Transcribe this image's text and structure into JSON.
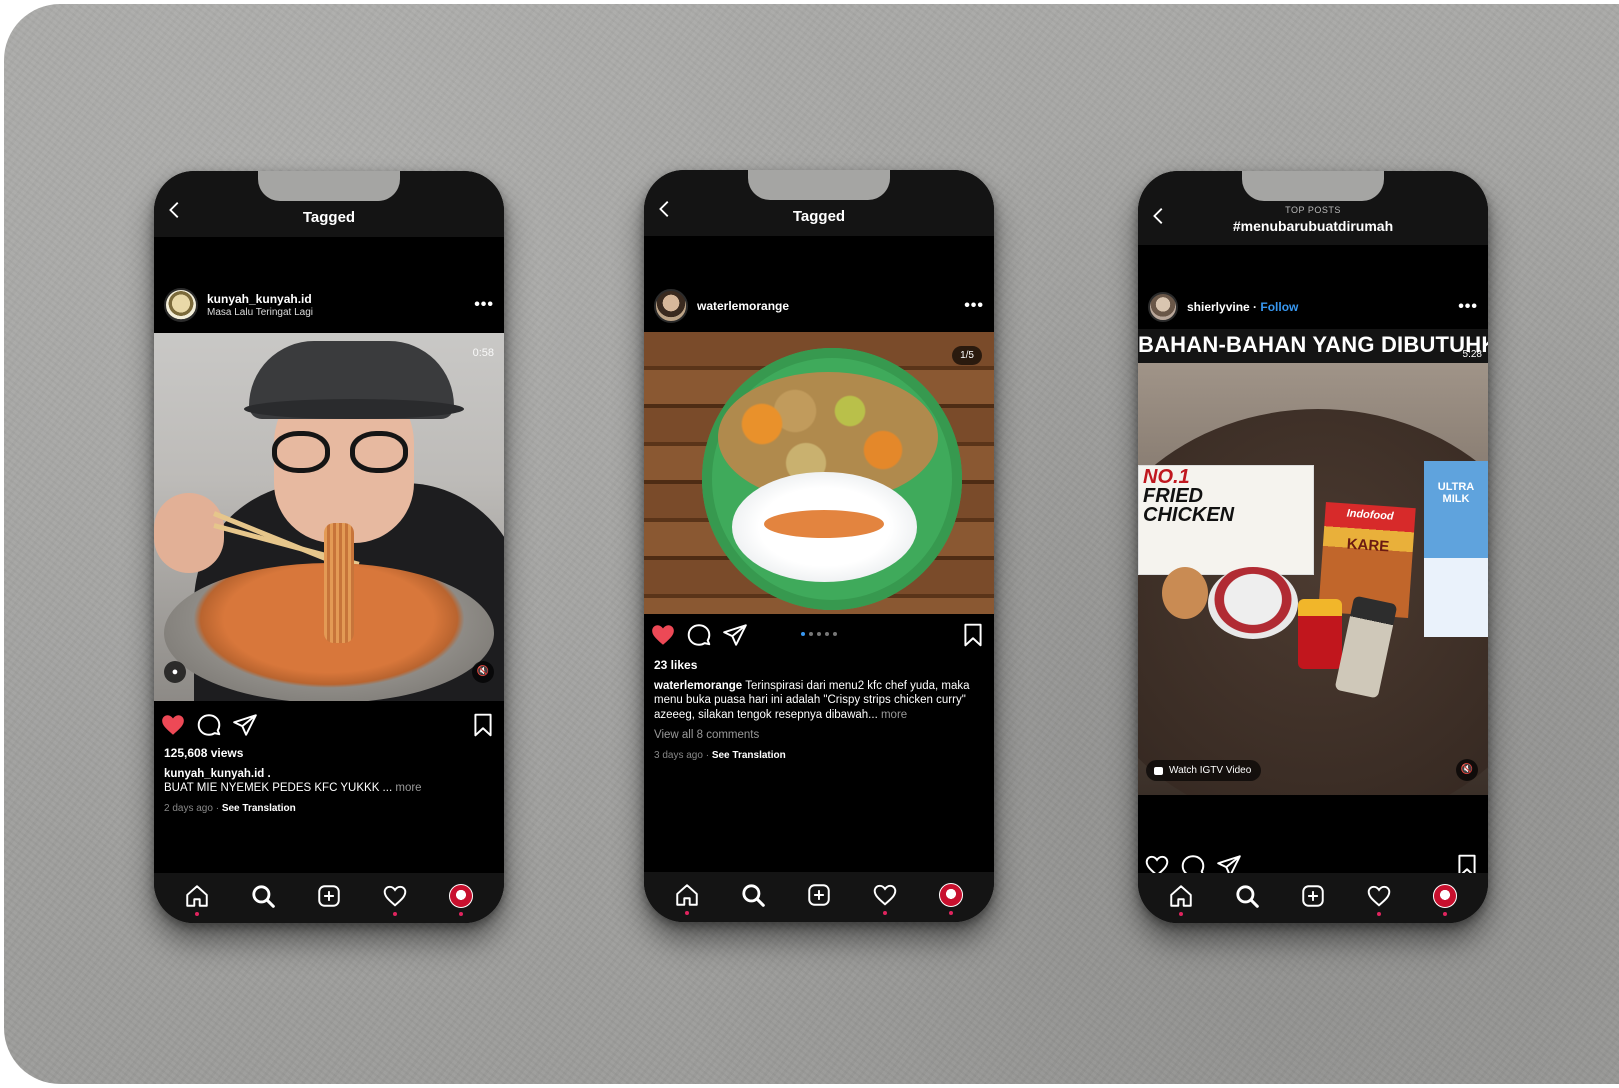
{
  "colors": {
    "accent_blue": "#3897f0",
    "like_red": "#ed4956",
    "notification_dot": "#e0245e",
    "screen_bg": "#000000"
  },
  "phones": [
    {
      "nav": {
        "title": "Tagged"
      },
      "post": {
        "username": "kunyah_kunyah.id",
        "subtitle": "Masa Lalu Teringat Lagi",
        "media_badge": "0:58",
        "likes": "125,608 views",
        "caption_user": "kunyah_kunyah.id .",
        "caption_text": "BUAT MIE NYEMEK PEDES KFC YUKKK ...",
        "more_label": "more",
        "time": "2 days ago",
        "see_translation": "See Translation"
      }
    },
    {
      "nav": {
        "title": "Tagged"
      },
      "post": {
        "username": "waterlemorange",
        "media_badge": "1/5",
        "likes": "23 likes",
        "caption_user": "waterlemorange",
        "caption_text": "Terinspirasi dari menu2 kfc chef yuda, maka menu buka puasa hari ini adalah \"Crispy strips chicken curry\" azeeeg, silakan tengok resepnya dibawah...",
        "more_label": "more",
        "comments": "View all 8 comments",
        "time": "3 days ago",
        "see_translation": "See Translation"
      }
    },
    {
      "nav": {
        "kicker": "TOP POSTS",
        "title": "#menubarubuatdirumah"
      },
      "post": {
        "username": "shierlyvine",
        "separator": "·",
        "follow_label": "Follow",
        "video_caption": "BAHAN-BAHAN YANG DIBUTUHKAN",
        "media_badge": "5:28",
        "box_label_line1": "NO.1",
        "box_label_line2": "FRIED",
        "box_label_line3": "CHICKEN",
        "pack_brand": "Indofood",
        "pack_name": "KARE",
        "milk_label": "ULTRA MILK",
        "igtv_label": "Watch IGTV Video"
      }
    }
  ],
  "icons": {
    "back": "chevron-left-icon",
    "more": "more-horizontal-icon",
    "like": "heart-icon",
    "comment": "comment-icon",
    "share": "send-icon",
    "save": "bookmark-icon",
    "home": "home-icon",
    "search": "search-icon",
    "new_post": "plus-square-icon",
    "activity": "heart-outline-icon",
    "profile": "profile-avatar"
  },
  "more_glyph": "•••"
}
